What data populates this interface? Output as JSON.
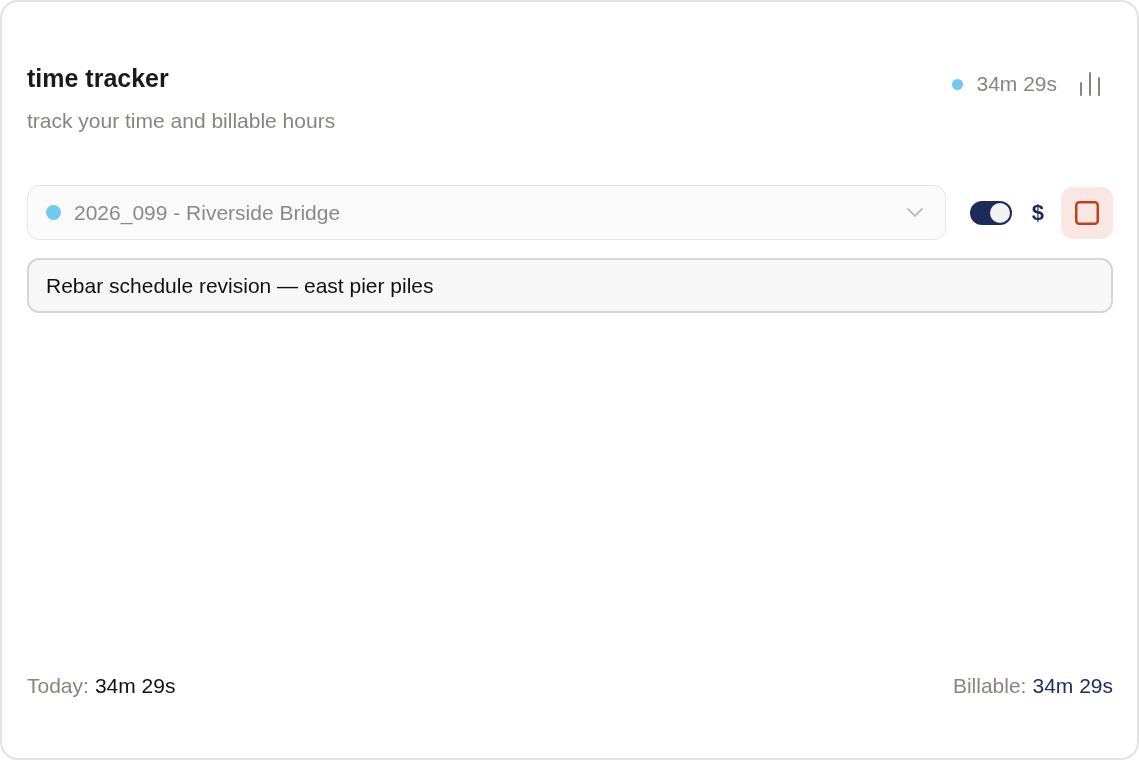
{
  "header": {
    "title": "time tracker",
    "subtitle": "track your time and billable hours"
  },
  "timer": {
    "running": true,
    "elapsed": "34m 29s"
  },
  "project": {
    "value": "2026_099 - Riverside Bridge",
    "color": "#6ecbef",
    "disabled": true
  },
  "billable": {
    "on": true,
    "label": "$"
  },
  "description": {
    "value": "Rebar schedule revision — east pier piles"
  },
  "footer": {
    "today": {
      "label": "Today:",
      "value": "34m 29s"
    },
    "billable": {
      "label": "Billable:",
      "value": "34m 29s"
    }
  }
}
